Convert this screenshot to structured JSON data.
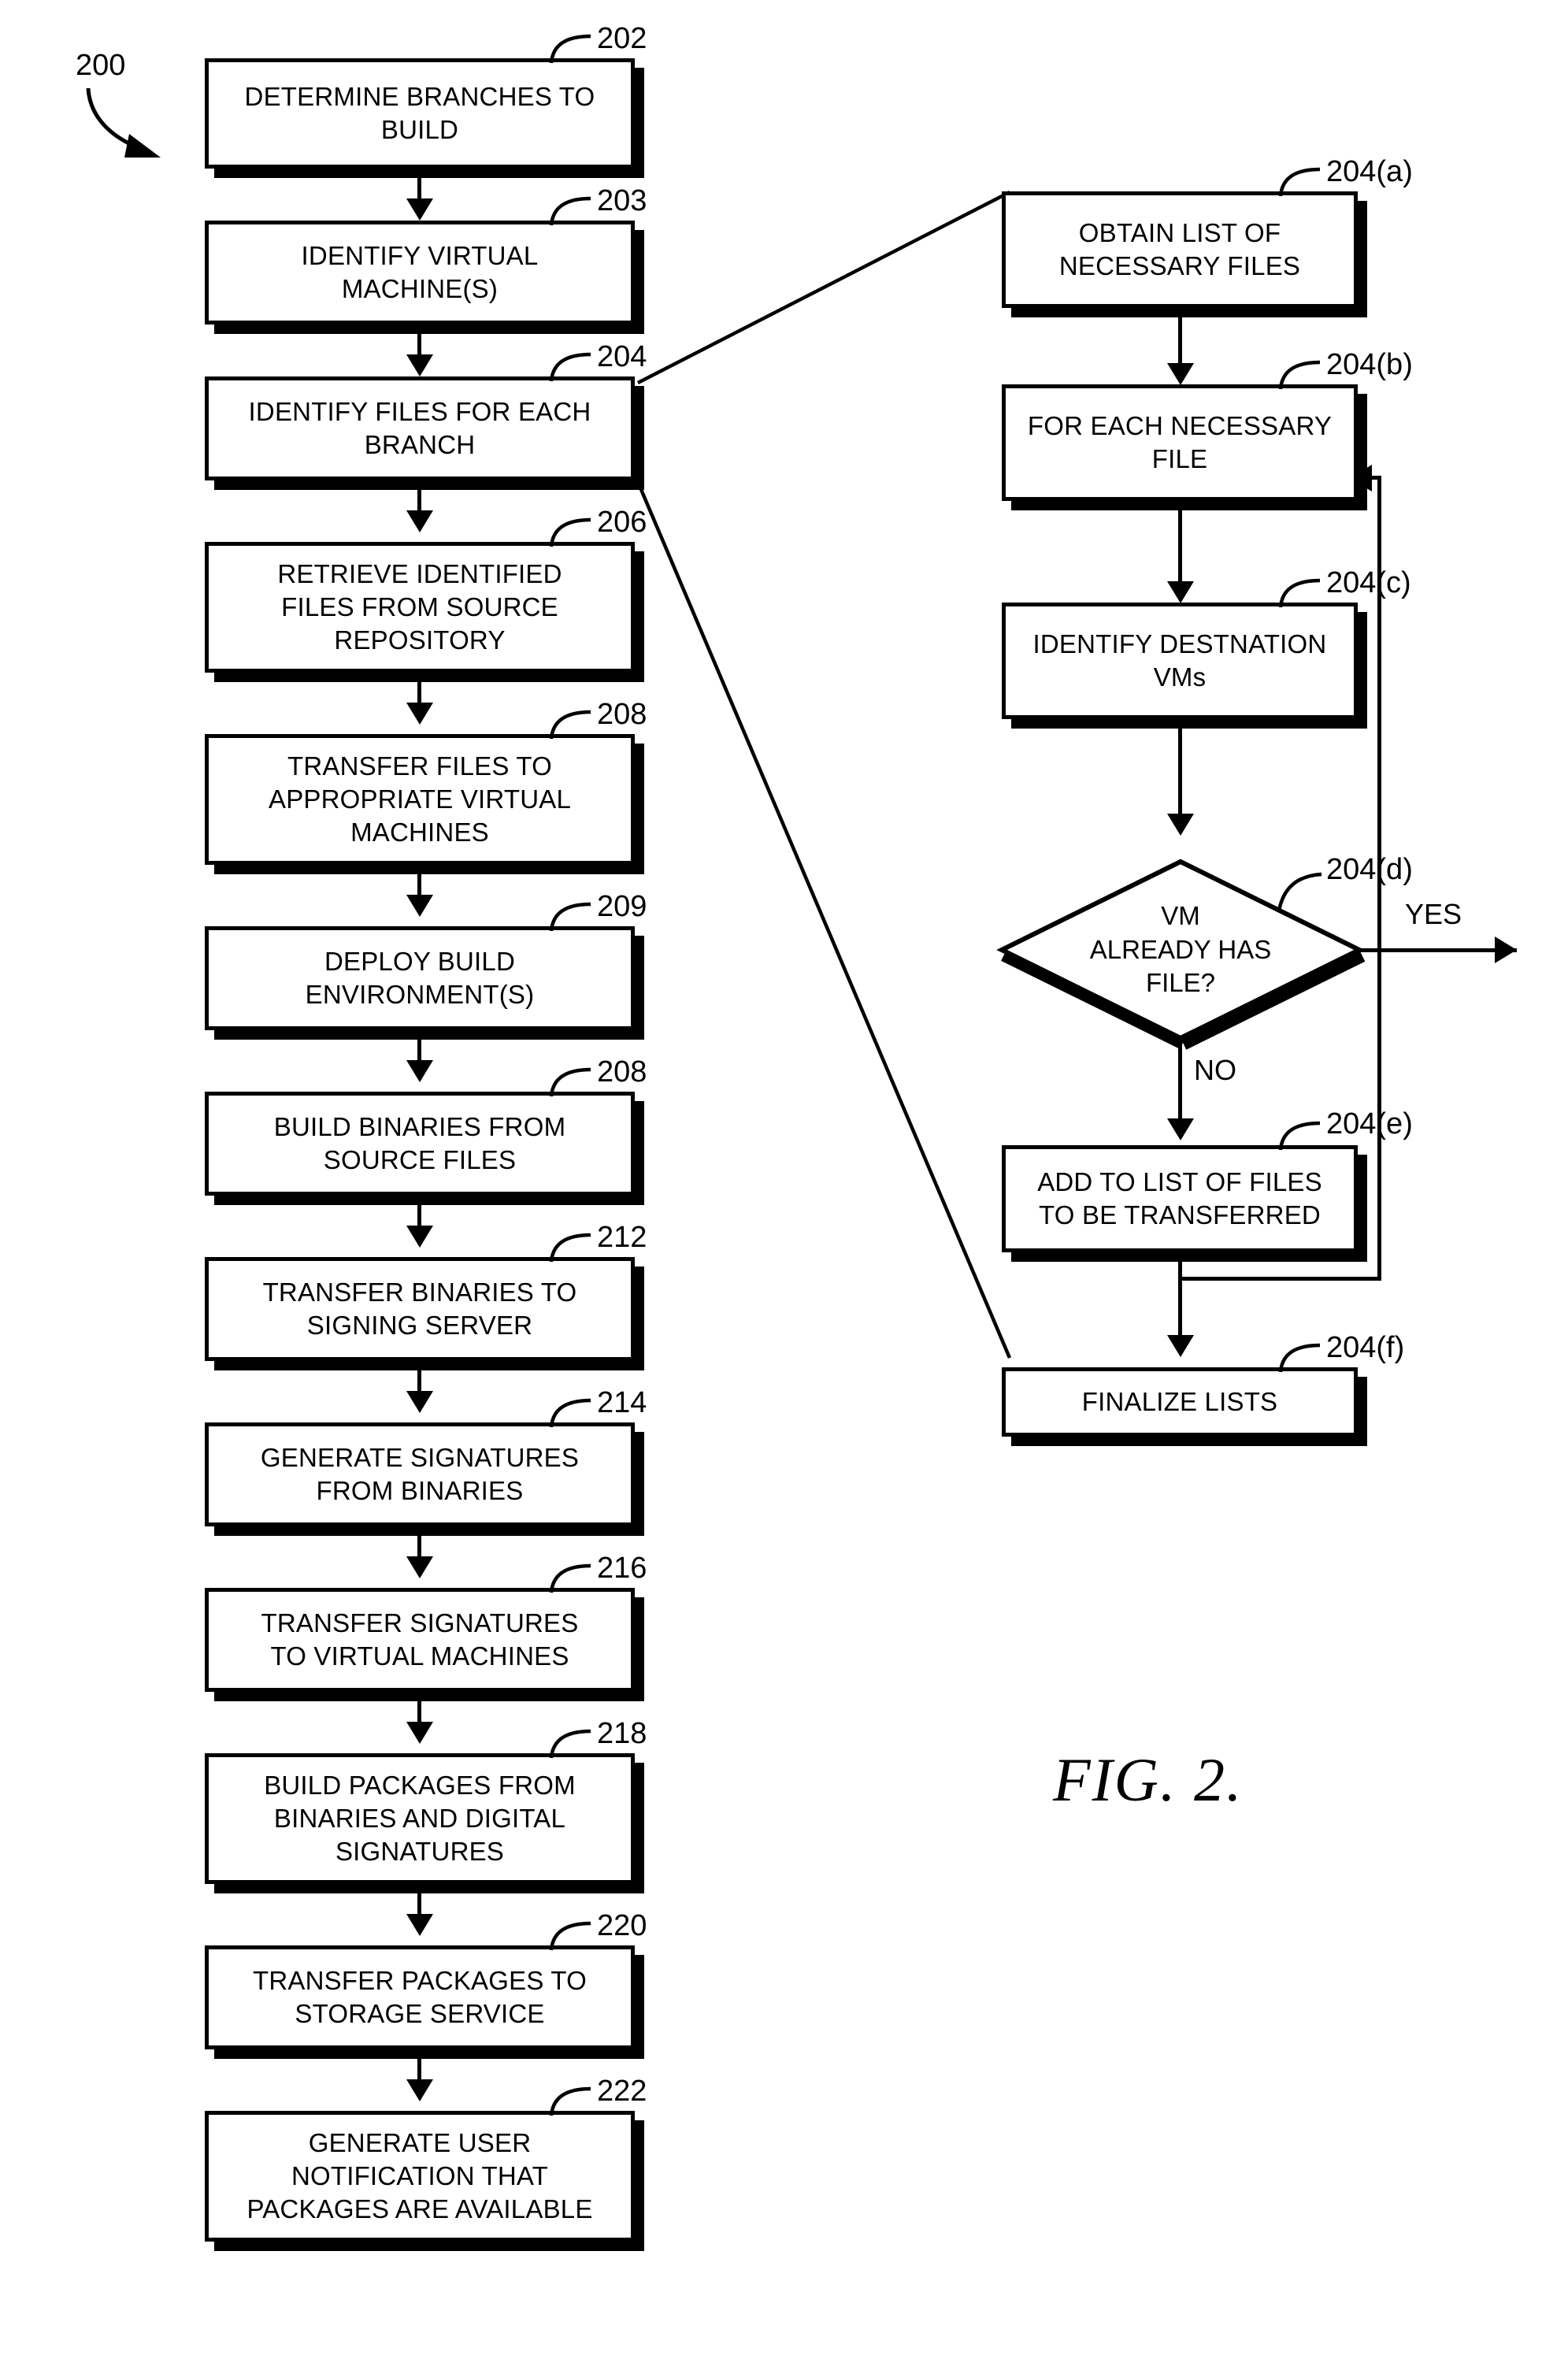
{
  "figure": {
    "caption": "FIG. 2.",
    "overall_ref": "200"
  },
  "main_flow": {
    "title": "Build pipeline flowchart",
    "steps": [
      {
        "ref": "202",
        "text": "DETERMINE BRANCHES TO\nBUILD"
      },
      {
        "ref": "203",
        "text": "IDENTIFY VIRTUAL\nMACHINE(S)"
      },
      {
        "ref": "204",
        "text": "IDENTIFY FILES FOR EACH\nBRANCH"
      },
      {
        "ref": "206",
        "text": "RETRIEVE IDENTIFIED\nFILES FROM SOURCE\nREPOSITORY"
      },
      {
        "ref": "208",
        "text": "TRANSFER FILES TO\nAPPROPRIATE VIRTUAL\nMACHINES"
      },
      {
        "ref": "209",
        "text": "DEPLOY BUILD\nENVIRONMENT(S)"
      },
      {
        "ref": "208",
        "text": "BUILD BINARIES FROM\nSOURCE FILES"
      },
      {
        "ref": "212",
        "text": "TRANSFER BINARIES TO\nSIGNING SERVER"
      },
      {
        "ref": "214",
        "text": "GENERATE SIGNATURES\nFROM BINARIES"
      },
      {
        "ref": "216",
        "text": "TRANSFER SIGNATURES\nTO VIRTUAL MACHINES"
      },
      {
        "ref": "218",
        "text": "BUILD PACKAGES FROM\nBINARIES AND DIGITAL\nSIGNATURES"
      },
      {
        "ref": "220",
        "text": "TRANSFER PACKAGES TO\nSTORAGE SERVICE"
      },
      {
        "ref": "222",
        "text": "GENERATE USER\nNOTIFICATION THAT\nPACKAGES ARE AVAILABLE"
      }
    ]
  },
  "sub_flow": {
    "title": "Expansion of step 204",
    "steps": [
      {
        "ref": "204(a)",
        "text": "OBTAIN LIST OF\nNECESSARY FILES",
        "shape": "process"
      },
      {
        "ref": "204(b)",
        "text": "FOR EACH NECESSARY\nFILE",
        "shape": "process"
      },
      {
        "ref": "204(c)",
        "text": "IDENTIFY DESTNATION\nVMs",
        "shape": "process"
      },
      {
        "ref": "204(d)",
        "text": "VM\nALREADY HAS\nFILE?",
        "shape": "decision"
      },
      {
        "ref": "204(e)",
        "text": "ADD TO LIST OF FILES\nTO BE TRANSFERRED",
        "shape": "process"
      },
      {
        "ref": "204(f)",
        "text": "FINALIZE LISTS",
        "shape": "process"
      }
    ],
    "branch_labels": {
      "yes": "YES",
      "no": "NO"
    }
  },
  "colors": {
    "ink": "#000000",
    "paper": "#ffffff"
  }
}
